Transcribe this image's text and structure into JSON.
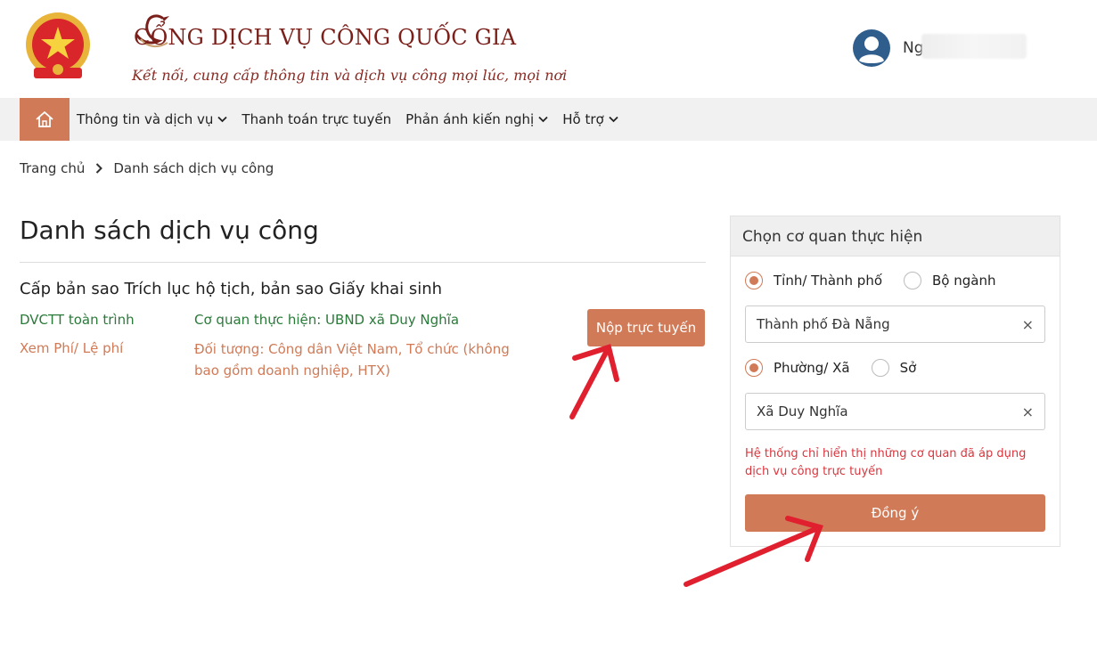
{
  "header": {
    "title": "CỔNG DỊCH VỤ CÔNG QUỐC GIA",
    "slogan": "Kết nối, cung cấp thông tin và dịch vụ công mọi lúc, mọi nơi",
    "user_name": "Ng"
  },
  "nav": {
    "items": [
      {
        "label": "Thông tin và dịch vụ",
        "has_dropdown": true
      },
      {
        "label": "Thanh toán trực tuyến",
        "has_dropdown": false
      },
      {
        "label": "Phản ánh kiến nghị",
        "has_dropdown": true
      },
      {
        "label": "Hỗ trợ",
        "has_dropdown": true
      }
    ]
  },
  "breadcrumb": {
    "home": "Trang chủ",
    "current": "Danh sách dịch vụ công"
  },
  "page": {
    "title": "Danh sách dịch vụ công"
  },
  "service": {
    "title": "Cấp bản sao Trích lục hộ tịch, bản sao Giấy khai sinh",
    "type": "DVCTT toàn trình",
    "agency": "Cơ quan thực hiện: UBND xã Duy Nghĩa",
    "fee": "Xem Phí/ Lệ phí",
    "target": "Đối tượng: Công dân Việt Nam, Tổ chức (không bao gồm doanh nghiệp, HTX)",
    "submit_label": "Nộp trực tuyến"
  },
  "panel": {
    "title": "Chọn cơ quan thực hiện",
    "level1": {
      "option_a": "Tỉnh/ Thành phố",
      "option_b": "Bộ ngành",
      "selected": "a"
    },
    "level1_value": "Thành phố Đà Nẵng",
    "level2": {
      "option_a": "Phường/ Xã",
      "option_b": "Sở",
      "selected": "a"
    },
    "level2_value": "Xã Duy Nghĩa",
    "clear_symbol": "×",
    "note": "Hệ thống chỉ hiển thị những cơ quan đã áp dụng dịch vụ công trực tuyến",
    "ok_label": "Đồng ý"
  },
  "colors": {
    "accent": "#d07a57",
    "brand_red": "#7a1f1a",
    "green": "#2a7a3a",
    "note_red": "#d9363e",
    "annotation_arrow": "#e0202e"
  }
}
